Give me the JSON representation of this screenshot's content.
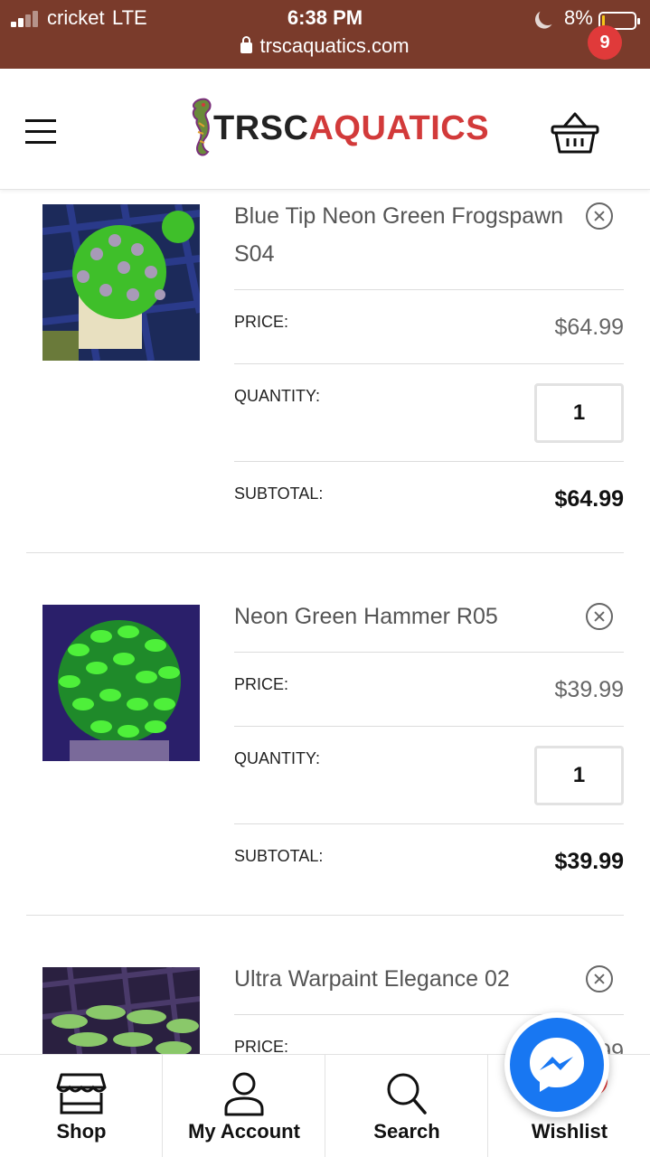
{
  "status_bar": {
    "carrier": "cricket",
    "network": "LTE",
    "time": "6:38 PM",
    "battery_percent": "8%",
    "battery_level": 0.08,
    "url": "trscaquatics.com"
  },
  "header": {
    "logo_part1": "TRSC",
    "logo_part2": "AQUATICS",
    "cart_count": "9",
    "brand_color": "#d23a3a"
  },
  "cart": {
    "labels": {
      "price": "PRICE:",
      "quantity": "QUANTITY:",
      "subtotal": "SUBTOTAL:"
    },
    "items": [
      {
        "title": "Blue Tip Neon Green Frogspawn S04",
        "price": "$64.99",
        "quantity": "1",
        "subtotal": "$64.99"
      },
      {
        "title": "Neon Green Hammer R05",
        "price": "$39.99",
        "quantity": "1",
        "subtotal": "$39.99"
      },
      {
        "title": "Ultra Warpaint Elegance 02",
        "price": "$…99"
      }
    ]
  },
  "bottom_nav": {
    "items": [
      {
        "label": "Shop",
        "icon": "shop-icon"
      },
      {
        "label": "My Account",
        "icon": "user-icon"
      },
      {
        "label": "Search",
        "icon": "search-icon"
      },
      {
        "label": "Wishlist",
        "icon": "heart-icon"
      }
    ]
  },
  "messenger": {
    "icon": "messenger-icon",
    "color": "#1877f2"
  }
}
